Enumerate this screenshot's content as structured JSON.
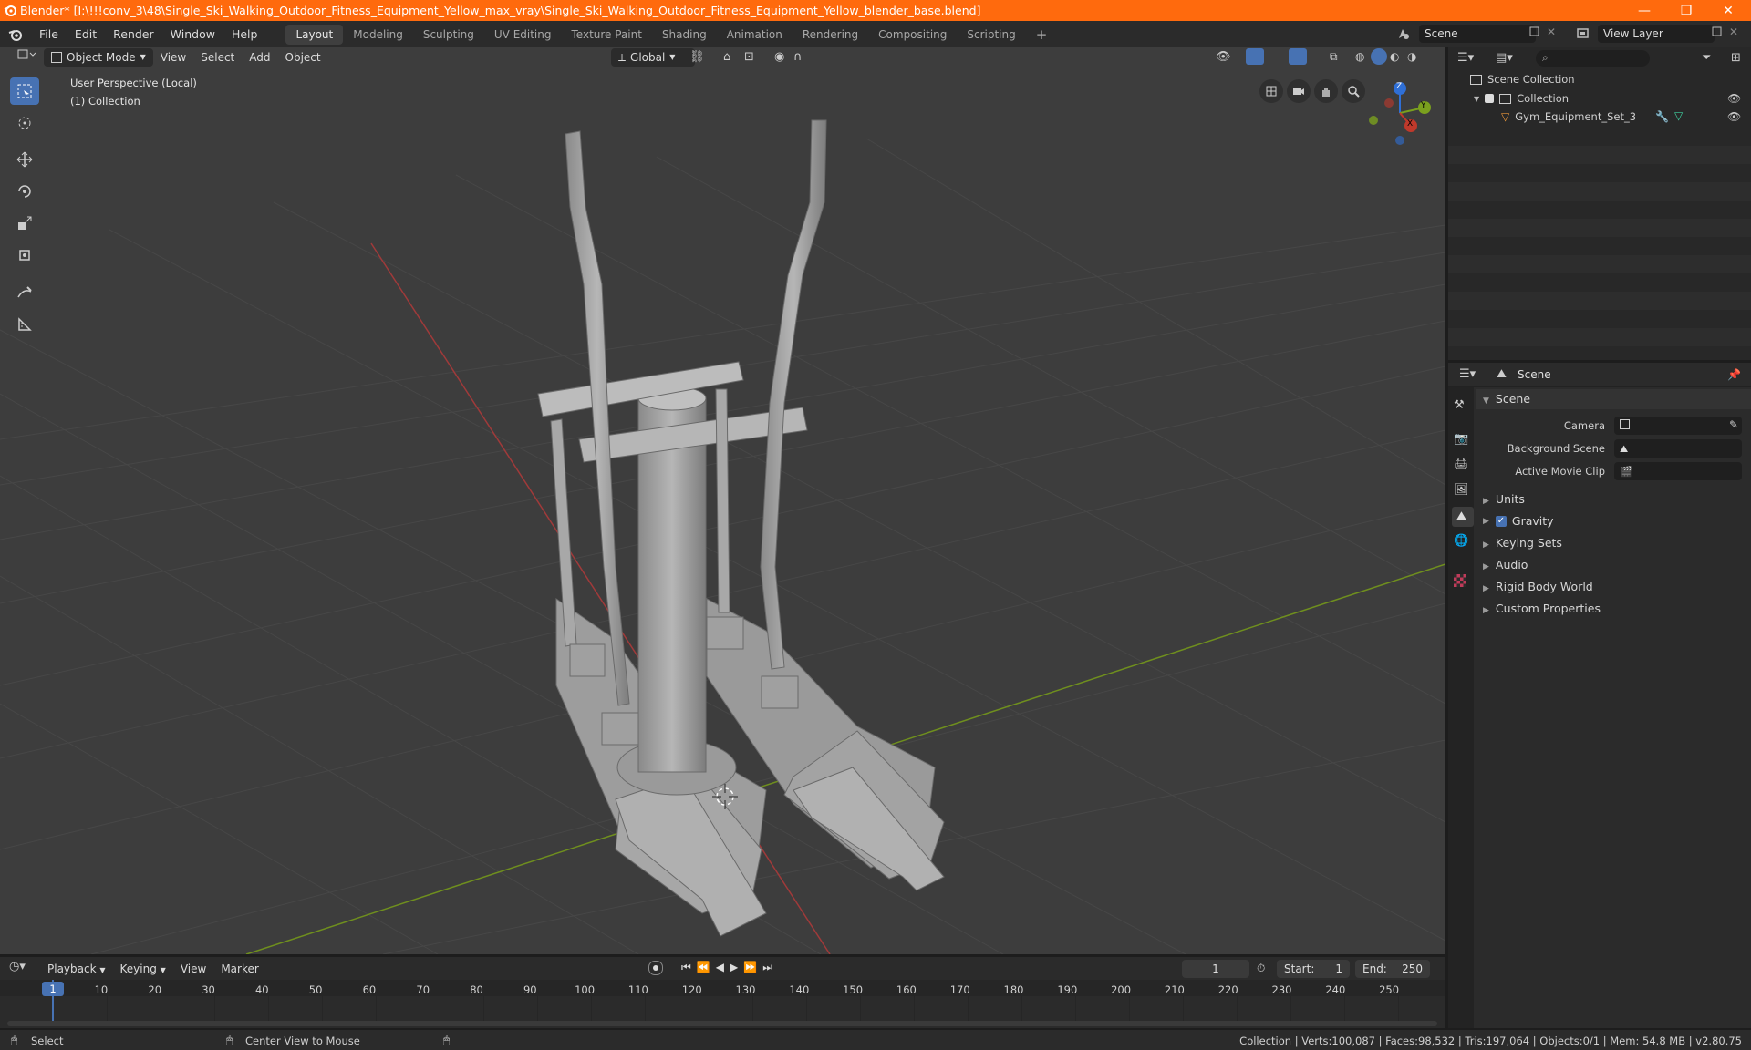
{
  "title_bar": {
    "title": "Blender* [I:\\!!!conv_3\\48\\Single_Ski_Walking_Outdoor_Fitness_Equipment_Yellow_max_vray\\Single_Ski_Walking_Outdoor_Fitness_Equipment_Yellow_blender_base.blend]",
    "controls": {
      "minimize": "—",
      "maximize": "❐",
      "close": "✕"
    }
  },
  "menu": [
    "File",
    "Edit",
    "Render",
    "Window",
    "Help"
  ],
  "workspaces": [
    "Layout",
    "Modeling",
    "Sculpting",
    "UV Editing",
    "Texture Paint",
    "Shading",
    "Animation",
    "Rendering",
    "Compositing",
    "Scripting"
  ],
  "add_workspace": "+",
  "scene_field": "Scene",
  "view_layer_field": "View Layer",
  "viewport": {
    "mode": "Object Mode",
    "menus": [
      "View",
      "Select",
      "Add",
      "Object"
    ],
    "orientation": "Global",
    "overlay_line1": "User Perspective (Local)",
    "overlay_line2": "(1) Collection",
    "gizmo": {
      "z": "Z",
      "y": "Y",
      "x": "X"
    }
  },
  "outliner": {
    "root": "Scene Collection",
    "collection": "Collection",
    "object": "Gym_Equipment_Set_3"
  },
  "properties": {
    "header": "Scene",
    "section": "Scene",
    "fields": [
      {
        "label": "Camera",
        "value": ""
      },
      {
        "label": "Background Scene",
        "value": ""
      },
      {
        "label": "Active Movie Clip",
        "value": ""
      }
    ],
    "panels": [
      "Units",
      "Gravity",
      "Keying Sets",
      "Audio",
      "Rigid Body World",
      "Custom Properties"
    ],
    "gravity_checked": true
  },
  "timeline": {
    "menus": [
      "Playback",
      "Keying",
      "View",
      "Marker"
    ],
    "current_frame": "1",
    "start_label": "Start:",
    "start": "1",
    "end_label": "End:",
    "end": "250",
    "ticks": [
      "1",
      "10",
      "20",
      "30",
      "40",
      "50",
      "60",
      "70",
      "80",
      "90",
      "100",
      "110",
      "120",
      "130",
      "140",
      "150",
      "160",
      "170",
      "180",
      "190",
      "200",
      "210",
      "220",
      "230",
      "240",
      "250"
    ]
  },
  "status_bar": {
    "select": "Select",
    "center_view": "Center View to Mouse",
    "stats": "Collection | Verts:100,087 | Faces:98,532 | Tris:197,064 | Objects:0/1 | Mem: 54.8 MB | v2.80.75"
  },
  "colors": {
    "title_bar": "#ff6a0d",
    "accent": "#4772b3",
    "x_axis": "#c0392b",
    "y_axis": "#7aa01e",
    "z_axis": "#2f6fd6"
  }
}
